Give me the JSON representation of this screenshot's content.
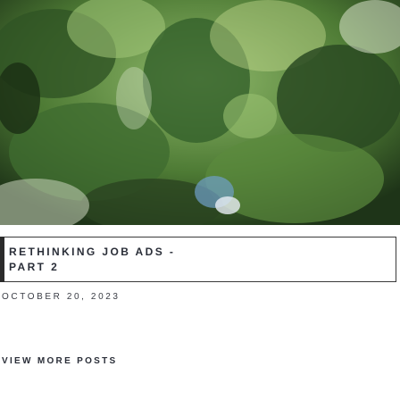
{
  "post": {
    "title_line1": "Rethinking Job Ads -",
    "title_line2": "Part 2",
    "date": "October 20, 2023",
    "image_alt": ""
  },
  "footer": {
    "view_more_label": "View More Posts"
  },
  "colors": {
    "text": "#2a2e38",
    "border": "#3a3a3a",
    "foliage_dark": "#1f3a1a",
    "foliage_light": "#6f9a4a"
  }
}
